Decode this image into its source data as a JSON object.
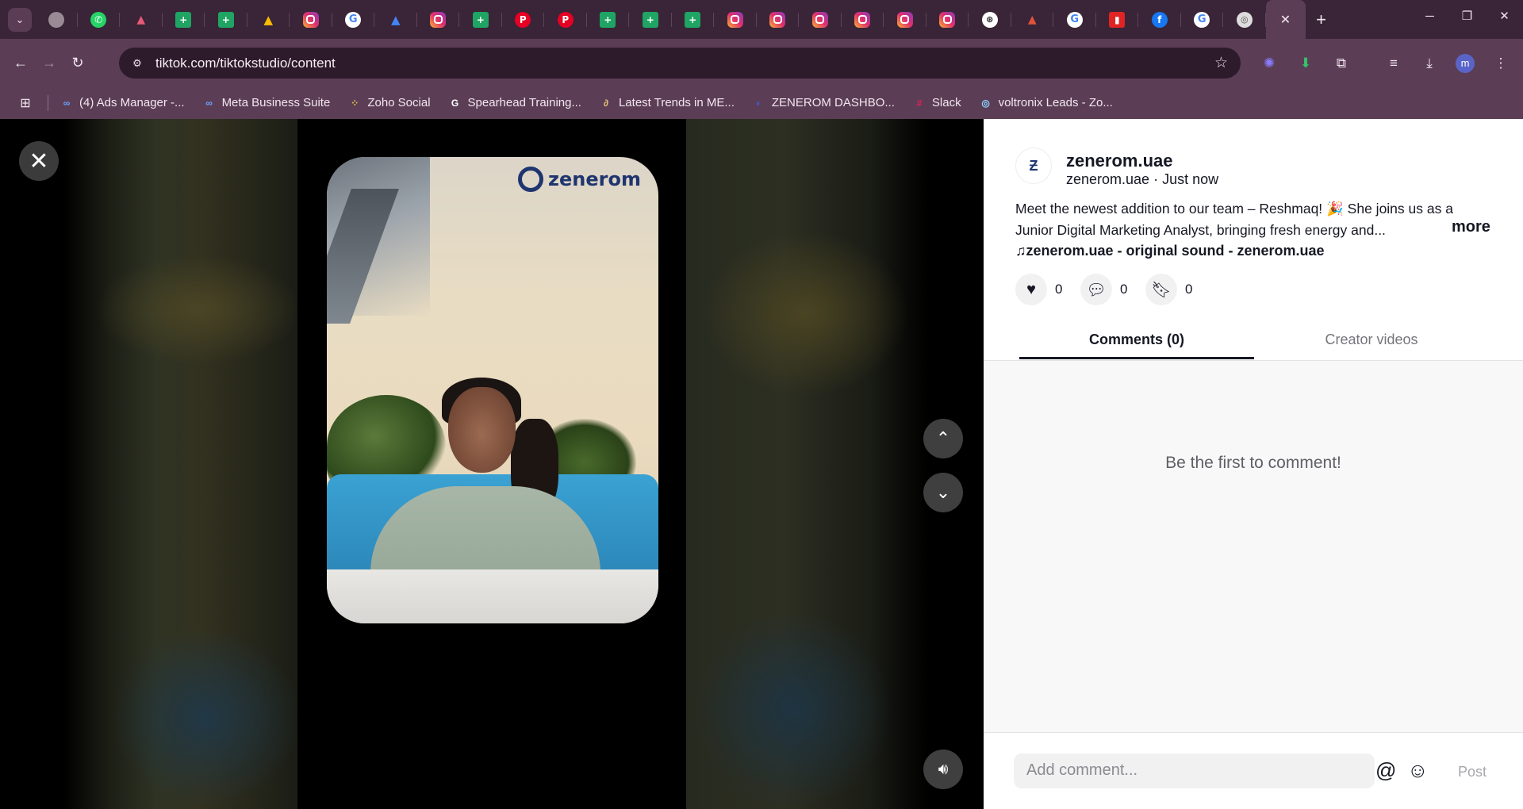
{
  "browser": {
    "tabs": [
      {
        "icon": "globe-icon",
        "cls": "globe",
        "glyph": ""
      },
      {
        "icon": "whatsapp-icon",
        "cls": "wa",
        "glyph": "✆"
      },
      {
        "icon": "hat-icon",
        "cls": "hat",
        "glyph": "▲"
      },
      {
        "icon": "google-sheets-icon",
        "cls": "sheets",
        "glyph": "+"
      },
      {
        "icon": "google-sheets-icon",
        "cls": "sheets",
        "glyph": "+"
      },
      {
        "icon": "google-drive-icon",
        "cls": "drive",
        "glyph": "▲"
      },
      {
        "icon": "instagram-icon",
        "cls": "ig",
        "glyph": ""
      },
      {
        "icon": "google-icon",
        "cls": "g",
        "glyph": "G"
      },
      {
        "icon": "google-ads-icon",
        "cls": "ads",
        "glyph": "▲"
      },
      {
        "icon": "instagram-icon",
        "cls": "ig",
        "glyph": ""
      },
      {
        "icon": "google-sheets-icon",
        "cls": "sheets",
        "glyph": "+"
      },
      {
        "icon": "pinterest-icon",
        "cls": "pin",
        "glyph": "P"
      },
      {
        "icon": "pinterest-icon",
        "cls": "pin",
        "glyph": "P"
      },
      {
        "icon": "google-sheets-icon",
        "cls": "sheets",
        "glyph": "+"
      },
      {
        "icon": "google-sheets-icon",
        "cls": "sheets",
        "glyph": "+"
      },
      {
        "icon": "google-sheets-icon",
        "cls": "sheets",
        "glyph": "+"
      },
      {
        "icon": "instagram-icon",
        "cls": "ig",
        "glyph": ""
      },
      {
        "icon": "instagram-icon",
        "cls": "ig",
        "glyph": ""
      },
      {
        "icon": "instagram-icon",
        "cls": "ig",
        "glyph": ""
      },
      {
        "icon": "instagram-icon",
        "cls": "ig",
        "glyph": ""
      },
      {
        "icon": "instagram-icon",
        "cls": "ig",
        "glyph": ""
      },
      {
        "icon": "instagram-icon",
        "cls": "ig",
        "glyph": ""
      },
      {
        "icon": "chatgpt-icon",
        "cls": "gpt",
        "glyph": "⊛"
      },
      {
        "icon": "semrush-icon",
        "cls": "shark",
        "glyph": "▲"
      },
      {
        "icon": "google-icon",
        "cls": "g",
        "glyph": "G"
      },
      {
        "icon": "red-app-icon",
        "cls": "red",
        "glyph": "▮"
      },
      {
        "icon": "facebook-icon",
        "cls": "fb",
        "glyph": "f"
      },
      {
        "icon": "google-icon",
        "cls": "g",
        "glyph": "G"
      },
      {
        "icon": "chrome-icon",
        "cls": "chrome",
        "glyph": "◎"
      }
    ],
    "url": "tiktok.com/tiktokstudio/content",
    "bookmarks": [
      {
        "label": "(4) Ads Manager -...",
        "icon": "meta-icon",
        "glyph": "∞",
        "color": "#6ea3ff"
      },
      {
        "label": "Meta Business Suite",
        "icon": "meta-icon",
        "glyph": "∞",
        "color": "#6ea3ff"
      },
      {
        "label": "Zoho Social",
        "icon": "zoho-icon",
        "glyph": "⁘",
        "color": "#f5c542"
      },
      {
        "label": "Spearhead Training...",
        "icon": "google-icon",
        "glyph": "G",
        "color": "#ffffff"
      },
      {
        "label": "Latest Trends in ME...",
        "icon": "link-icon",
        "glyph": "∂",
        "color": "#e8c27a"
      },
      {
        "label": "ZENEROM DASHBO...",
        "icon": "zenerom-icon",
        "glyph": "◐",
        "color": "#3b5bd6"
      },
      {
        "label": "Slack",
        "icon": "slack-icon",
        "glyph": "#",
        "color": "#e01e5a"
      },
      {
        "label": "voltronix Leads - Zo...",
        "icon": "voltronix-icon",
        "glyph": "◎",
        "color": "#8fd3ff"
      }
    ]
  },
  "video": {
    "logo_text": "zenerom"
  },
  "post": {
    "avatar_text": "Ƶ",
    "username": "zenerom.uae",
    "handle": "zenerom.uae",
    "time": "Just now",
    "caption": "Meet the newest addition to our team – Reshmaq! 🎉 She joins us as a Junior Digital Marketing Analyst, bringing fresh energy and...",
    "more": "more",
    "sound": "♫zenerom.uae - original sound - zenerom.uae",
    "likes": "0",
    "comments": "0",
    "saves": "0"
  },
  "tabs": {
    "comments": "Comments (0)",
    "creator": "Creator videos"
  },
  "comments": {
    "empty": "Be the first to comment!",
    "placeholder": "Add comment...",
    "post": "Post"
  }
}
